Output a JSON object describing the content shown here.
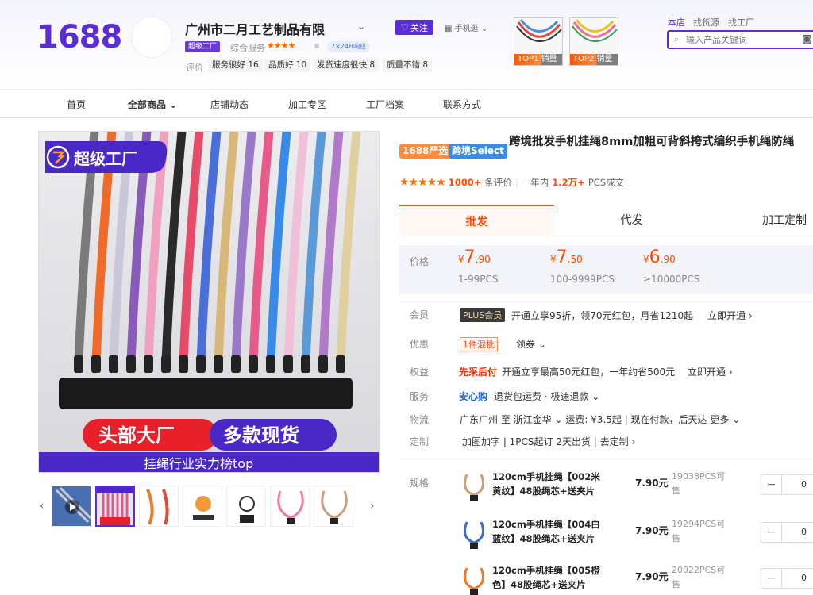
{
  "header": {
    "logo": "1688",
    "shop_name": "广州市二月工艺制品有限",
    "follow_label": "关注",
    "mobile_label": "手机逛",
    "super_badge": "超级工厂",
    "service_label": "综合服务",
    "service_stars": "★★★★",
    "badge_247": "7×24H响应",
    "eval_label": "评价",
    "chips": [
      "服务很好 16",
      "品质好 10",
      "发货速度很快 8",
      "质量不错 8"
    ],
    "top_tags": [
      "TOP1 销量",
      "TOP2 销量"
    ],
    "search_tabs": [
      "本店",
      "找货源",
      "找工厂"
    ],
    "search_placeholder": "输入产品关键词"
  },
  "nav": {
    "items": [
      "首页",
      "全部商品",
      "店铺动态",
      "加工专区",
      "工厂档案",
      "联系方式"
    ]
  },
  "gallery": {
    "banner_top": "超级工厂",
    "banner_left": "头部大厂",
    "banner_right": "多款现货",
    "banner_bottom": "挂绳行业实力榜top",
    "prev_arrow": "‹",
    "next_arrow": "›"
  },
  "product": {
    "tag1": "1688严选",
    "tag2": "跨境Select",
    "title": "跨境批发手机挂绳8mm加粗可背斜挎式编织手机绳防绳",
    "stars": "★★★★★",
    "reviews_count": "1000+",
    "reviews_label": "条评价",
    "sold_prefix": "一年内",
    "sold_count": "1.2万+",
    "sold_suffix": "PCS成交"
  },
  "tabs": [
    "批发",
    "代发",
    "加工定制"
  ],
  "pricing": {
    "label": "价格",
    "tiers": [
      {
        "currency": "¥",
        "int": "7",
        "dec": ".90",
        "qty": "1-99PCS"
      },
      {
        "currency": "¥",
        "int": "7",
        "dec": ".50",
        "qty": "100-9999PCS"
      },
      {
        "currency": "¥",
        "int": "6",
        "dec": ".90",
        "qty": "≥10000PCS"
      }
    ]
  },
  "details": {
    "member_label": "会员",
    "plus_badge": "PLUS会员",
    "member_text": "开通立享95折，领70元红包，月省1210起",
    "member_link": "立即开通 ›",
    "discount_label": "优惠",
    "mix_badge": "1件混批",
    "coupon": "领券 ⌄",
    "rights_label": "权益",
    "rights_badge": "先采后付",
    "rights_text": "开通立享最高50元红包，一年约省500元",
    "rights_link": "立即开通 ›",
    "service_label": "服务",
    "service_badge": "安心购",
    "service_text": "退货包运费 · 极速退款 ⌄",
    "logistics_label": "物流",
    "logistics_text": "广东广州 至 浙江金华 ⌄  运费: ¥3.5起 | 现在付款，后天达 更多 ⌄",
    "custom_label": "定制",
    "custom_text": "加图加字 | 1PCS起订 2天出货 | 去定制 ›",
    "spec_label": "规格"
  },
  "skus": [
    {
      "name": "120cm手机挂绳【002米黄纹】48股绳芯+送夹片",
      "price": "7.90元",
      "stock": "19038PCS可售",
      "qty": "0",
      "color": "#c9a079"
    },
    {
      "name": "120cm手机挂绳【004白蓝纹】48股绳芯+送夹片",
      "price": "7.90元",
      "stock": "19294PCS可售",
      "qty": "0",
      "color": "#3a6fc8"
    },
    {
      "name": "120cm手机挂绳【005橙色】48股绳芯+送夹片",
      "price": "7.90元",
      "stock": "20022PCS可售",
      "qty": "0",
      "color": "#f07a2a"
    }
  ],
  "colors": {
    "brand": "#5a2dd8",
    "accent": "#ff4a00"
  }
}
